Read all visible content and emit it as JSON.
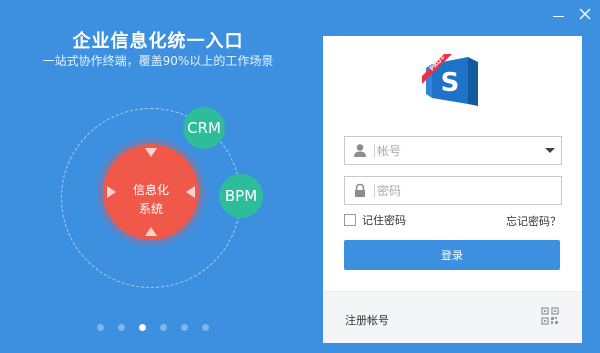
{
  "promo": {
    "headline": "企业信息化统一入口",
    "subline": "一站式协作终端，覆盖90%以上的工作场景",
    "core_line1": "信息化",
    "core_line2": "系统",
    "bubble_crm": "CRM",
    "bubble_bpm": "BPM",
    "carousel": {
      "total": 6,
      "active_index": 2
    }
  },
  "login": {
    "logo_badge": "PRO+",
    "logo_letter": "S",
    "account_placeholder": "帐号",
    "password_placeholder": "密码",
    "remember_label": "记住密码",
    "forgot_label": "忘记密码？",
    "login_button": "登录",
    "register_label": "注册帐号"
  },
  "icons": {
    "minimize": "minimize-icon",
    "close": "close-icon",
    "account": "user-icon",
    "password": "lock-icon",
    "dropdown": "chevron-down-icon",
    "qr": "qr-code-icon"
  },
  "colors": {
    "background": "#3d8fe0",
    "accent_red": "#f0594a",
    "accent_teal": "#2ebd9b",
    "logo_blue": "#1e73c8",
    "logo_ribbon": "#e8334a"
  }
}
